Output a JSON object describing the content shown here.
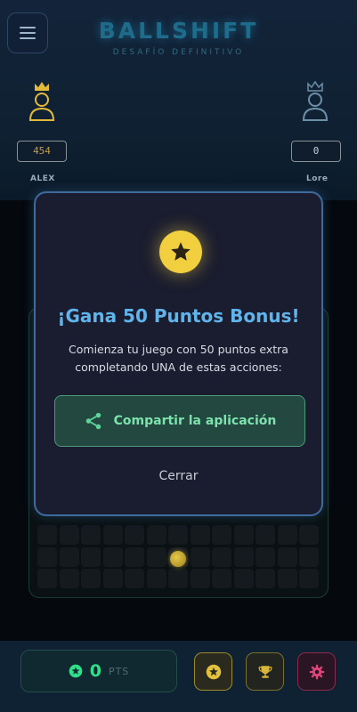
{
  "header": {
    "title": "BALLSHIFT",
    "subtitle": "DESAFÍO DEFINITIVO"
  },
  "players": {
    "left": {
      "name": "ALEX",
      "score": "454"
    },
    "right": {
      "name": "Lore",
      "score": "0"
    }
  },
  "modal": {
    "title": "¡Gana 50 Puntos Bonus!",
    "description": "Comienza tu juego con 50 puntos extra completando UNA de estas acciones:",
    "share_label": "Compartir la aplicación",
    "close_label": "Cerrar"
  },
  "bottom_bar": {
    "points": "0",
    "points_unit": "PTS"
  },
  "colors": {
    "accent_blue": "#5fb4ec",
    "accent_green": "#7de3ae",
    "gold": "#f1cf3e",
    "pink": "#e0457a"
  },
  "icons": {
    "menu": "menu-icon",
    "crown": "crown-icon",
    "user": "user-icon",
    "star": "star-icon",
    "share": "share-icon",
    "trophy": "trophy-icon",
    "gear": "gear-icon"
  }
}
